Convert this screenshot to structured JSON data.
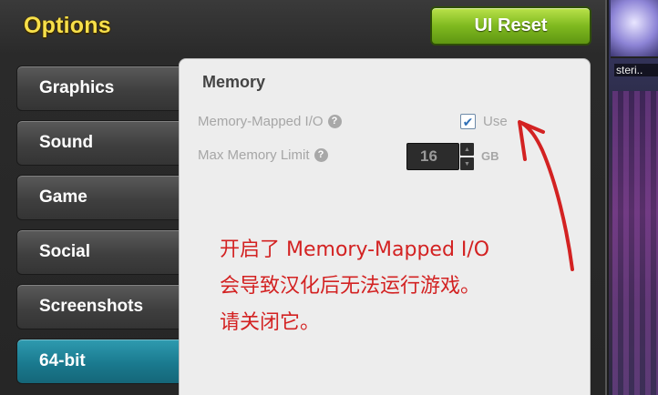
{
  "window": {
    "title": "Options",
    "reset_button": "UI Reset"
  },
  "nav": {
    "items": [
      {
        "label": "Graphics",
        "active": false
      },
      {
        "label": "Sound",
        "active": false
      },
      {
        "label": "Game",
        "active": false
      },
      {
        "label": "Social",
        "active": false
      },
      {
        "label": "Screenshots",
        "active": false
      },
      {
        "label": "64-bit",
        "active": true
      }
    ]
  },
  "panel": {
    "section_title": "Memory",
    "memory_mapped": {
      "label": "Memory-Mapped I/O",
      "checked": true,
      "checkbox_label": "Use"
    },
    "max_memory": {
      "label": "Max Memory Limit",
      "value": "16",
      "unit": "GB"
    }
  },
  "annotation": {
    "line1": "开启了 Memory-Mapped I/O",
    "line2": "会导致汉化后无法运行游戏。",
    "line3": "请关闭它。",
    "color": "#d32222"
  },
  "side": {
    "character_label": "steri.."
  },
  "icons": {
    "help": "?",
    "check": "✔",
    "up": "▲",
    "down": "▼"
  }
}
